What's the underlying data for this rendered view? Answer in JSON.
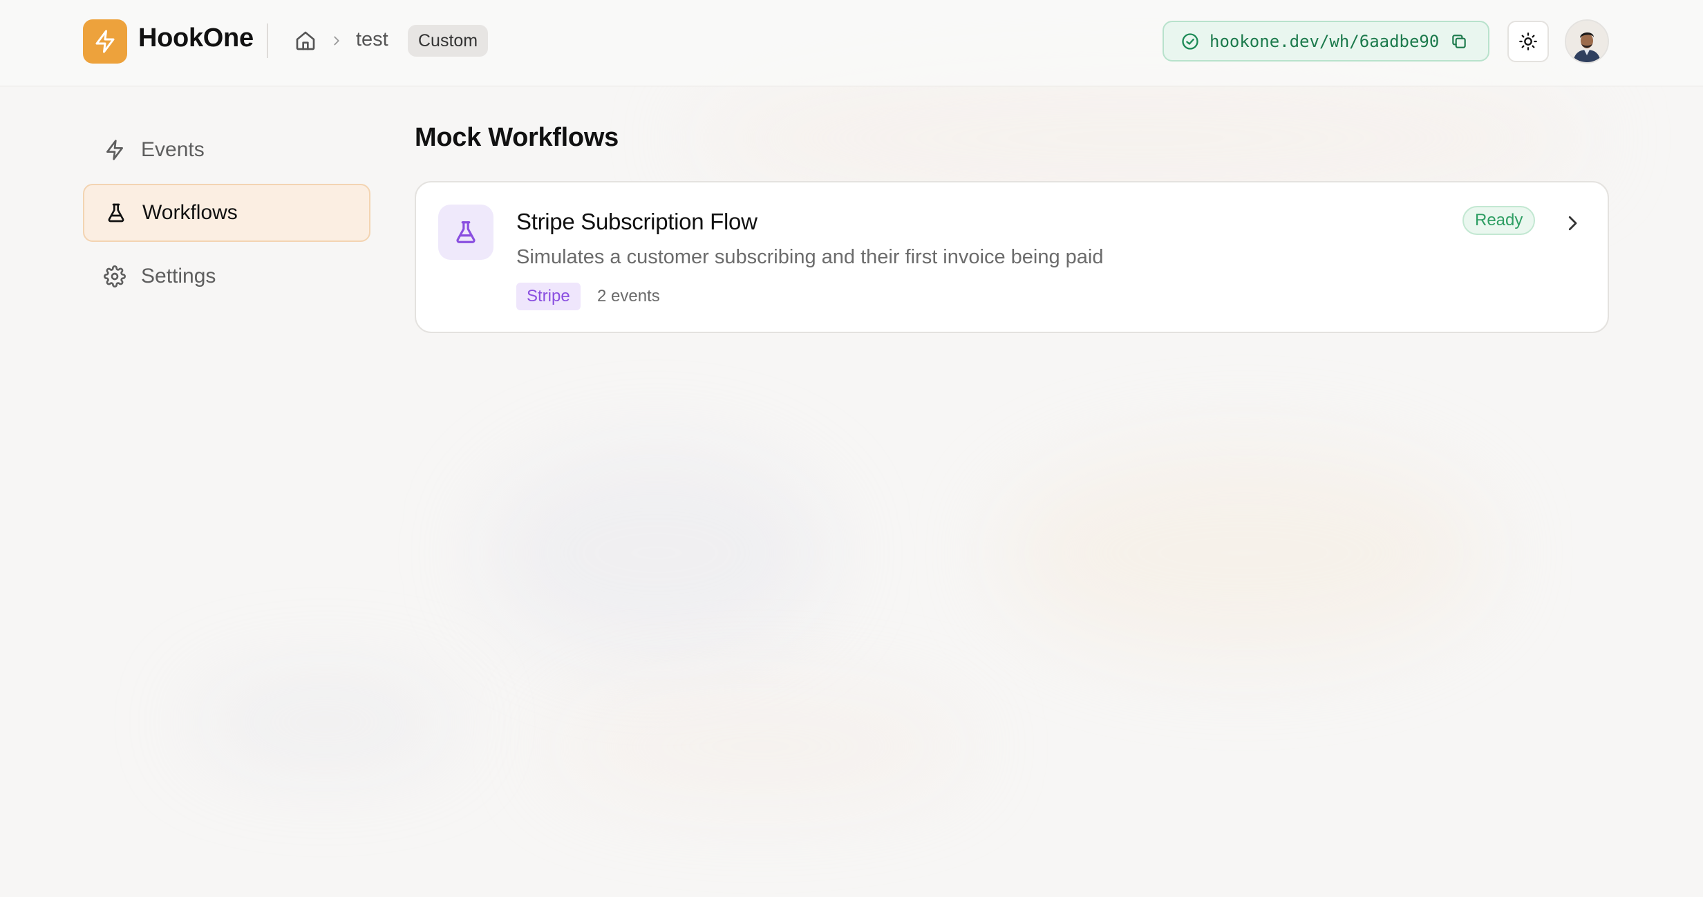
{
  "app": {
    "name": "HookOne",
    "accent": "#eda23c"
  },
  "breadcrumb": {
    "project": "test",
    "badge": "Custom"
  },
  "webhook": {
    "url": "hookone.dev/wh/6aadbe90"
  },
  "sidebar": {
    "items": [
      {
        "label": "Events",
        "icon": "lightning-icon",
        "active": false
      },
      {
        "label": "Workflows",
        "icon": "flask-icon",
        "active": true
      },
      {
        "label": "Settings",
        "icon": "gear-icon",
        "active": false
      }
    ]
  },
  "main": {
    "title": "Mock Workflows",
    "workflows": [
      {
        "title": "Stripe Subscription Flow",
        "description": "Simulates a customer subscribing and their first invoice being paid",
        "tag": "Stripe",
        "events": "2 events",
        "status": "Ready"
      }
    ]
  },
  "colors": {
    "ready": "#2e9e63",
    "stripe_tag": "#8a4fe0",
    "active_nav": "#fbeee2"
  }
}
